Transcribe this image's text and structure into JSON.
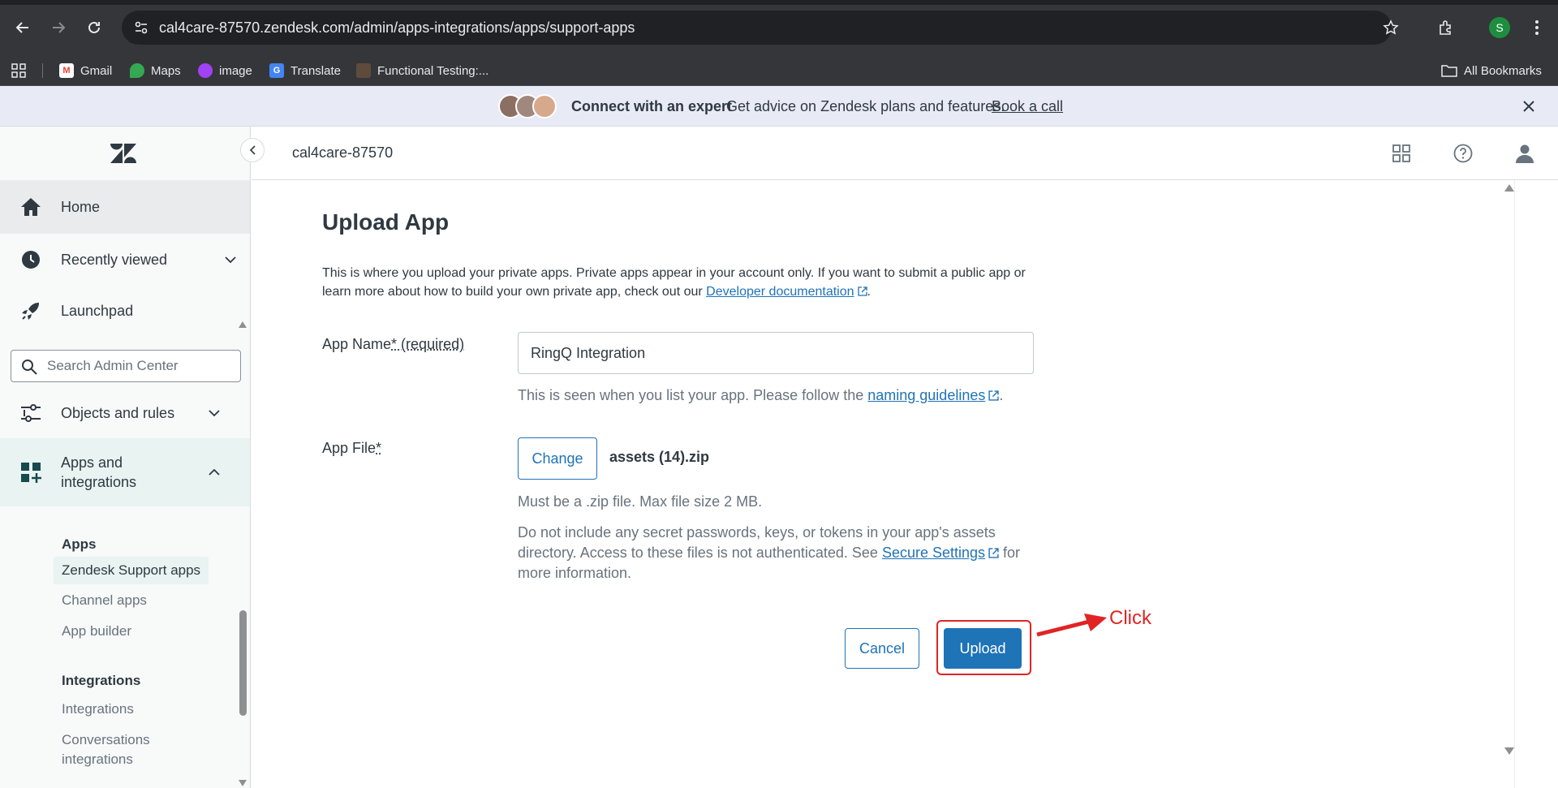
{
  "browser": {
    "url": "cal4care-87570.zendesk.com/admin/apps-integrations/apps/support-apps",
    "profile_initial": "S",
    "bookmarks": [
      {
        "label": "Gmail",
        "icon": "gmail-icon"
      },
      {
        "label": "Maps",
        "icon": "maps-icon"
      },
      {
        "label": "image",
        "icon": "image-icon"
      },
      {
        "label": "Translate",
        "icon": "translate-icon"
      },
      {
        "label": "Functional Testing:...",
        "icon": "functional-testing-icon"
      }
    ],
    "all_bookmarks": "All Bookmarks"
  },
  "banner": {
    "title": "Connect with an expert",
    "text": "Get advice on Zendesk plans and features.",
    "link": "Book a call"
  },
  "sidebar": {
    "home": "Home",
    "recently_viewed": "Recently viewed",
    "launchpad": "Launchpad",
    "search_placeholder": "Search Admin Center",
    "objects_and_rules": "Objects and rules",
    "apps_and_integrations": "Apps and integrations",
    "apps_heading": "Apps",
    "apps_items": [
      "Zendesk Support apps",
      "Channel apps",
      "App builder"
    ],
    "integrations_heading": "Integrations",
    "integrations_items": [
      "Integrations",
      "Conversations integrations"
    ]
  },
  "header": {
    "account": "cal4care-87570"
  },
  "main": {
    "title": "Upload App",
    "intro_text": "This is where you upload your private apps. Private apps appear in your account only. If you want to submit a public app or learn more about how to build your own private app, check out our",
    "intro_link": "Developer documentation",
    "intro_end": ".",
    "app_name_label": "App Name",
    "app_name_required": "* (required)",
    "app_name_value": "RingQ Integration",
    "app_name_hint": "This is seen when you list your app. Please follow the",
    "app_name_hint_link": "naming guidelines",
    "app_name_hint_end": ".",
    "app_file_label": "App File",
    "app_file_required": "*",
    "change_button": "Change",
    "file_name": "assets (14).zip",
    "file_hint": "Must be a .zip file. Max file size 2 MB.",
    "secret_hint": "Do not include any secret passwords, keys, or tokens in your app's assets directory. Access to these files is not authenticated. See",
    "secret_link": "Secure Settings",
    "secret_end": "for more information.",
    "cancel_button": "Cancel",
    "upload_button": "Upload"
  },
  "annotation": {
    "text": "Click",
    "color": "#e02424"
  },
  "colors": {
    "primary": "#1f73b7",
    "active_nav": "#e8f3f2",
    "banner_bg": "#e8eaf6"
  }
}
